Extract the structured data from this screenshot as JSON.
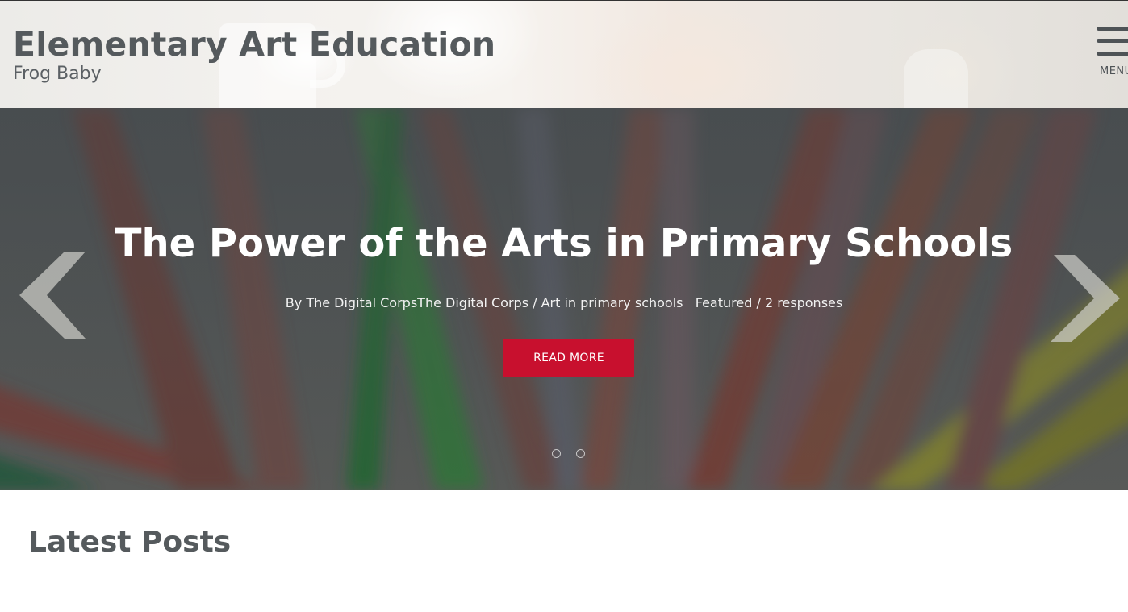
{
  "header": {
    "site_title": "Elementary Art Education",
    "tagline": "Frog Baby",
    "menu_label": "MENU",
    "menu_icon": "hamburger-icon"
  },
  "hero": {
    "title": "The Power of the Arts in Primary Schools",
    "meta": {
      "by": "By ",
      "author": "The Digital Corps",
      "author_repeat": "The Digital Corps",
      "sep1": " / ",
      "category": "Art in primary schools",
      "tag": "Featured",
      "sep2": " / ",
      "responses": "2 responses"
    },
    "button_label": "READ MORE",
    "prev_icon": "chevron-left-icon",
    "next_icon": "chevron-right-icon",
    "slide_count": 2,
    "active_slide": 1
  },
  "colors": {
    "accent": "#c8102e",
    "text": "#555a5d"
  },
  "latest": {
    "heading": "Latest Posts"
  }
}
